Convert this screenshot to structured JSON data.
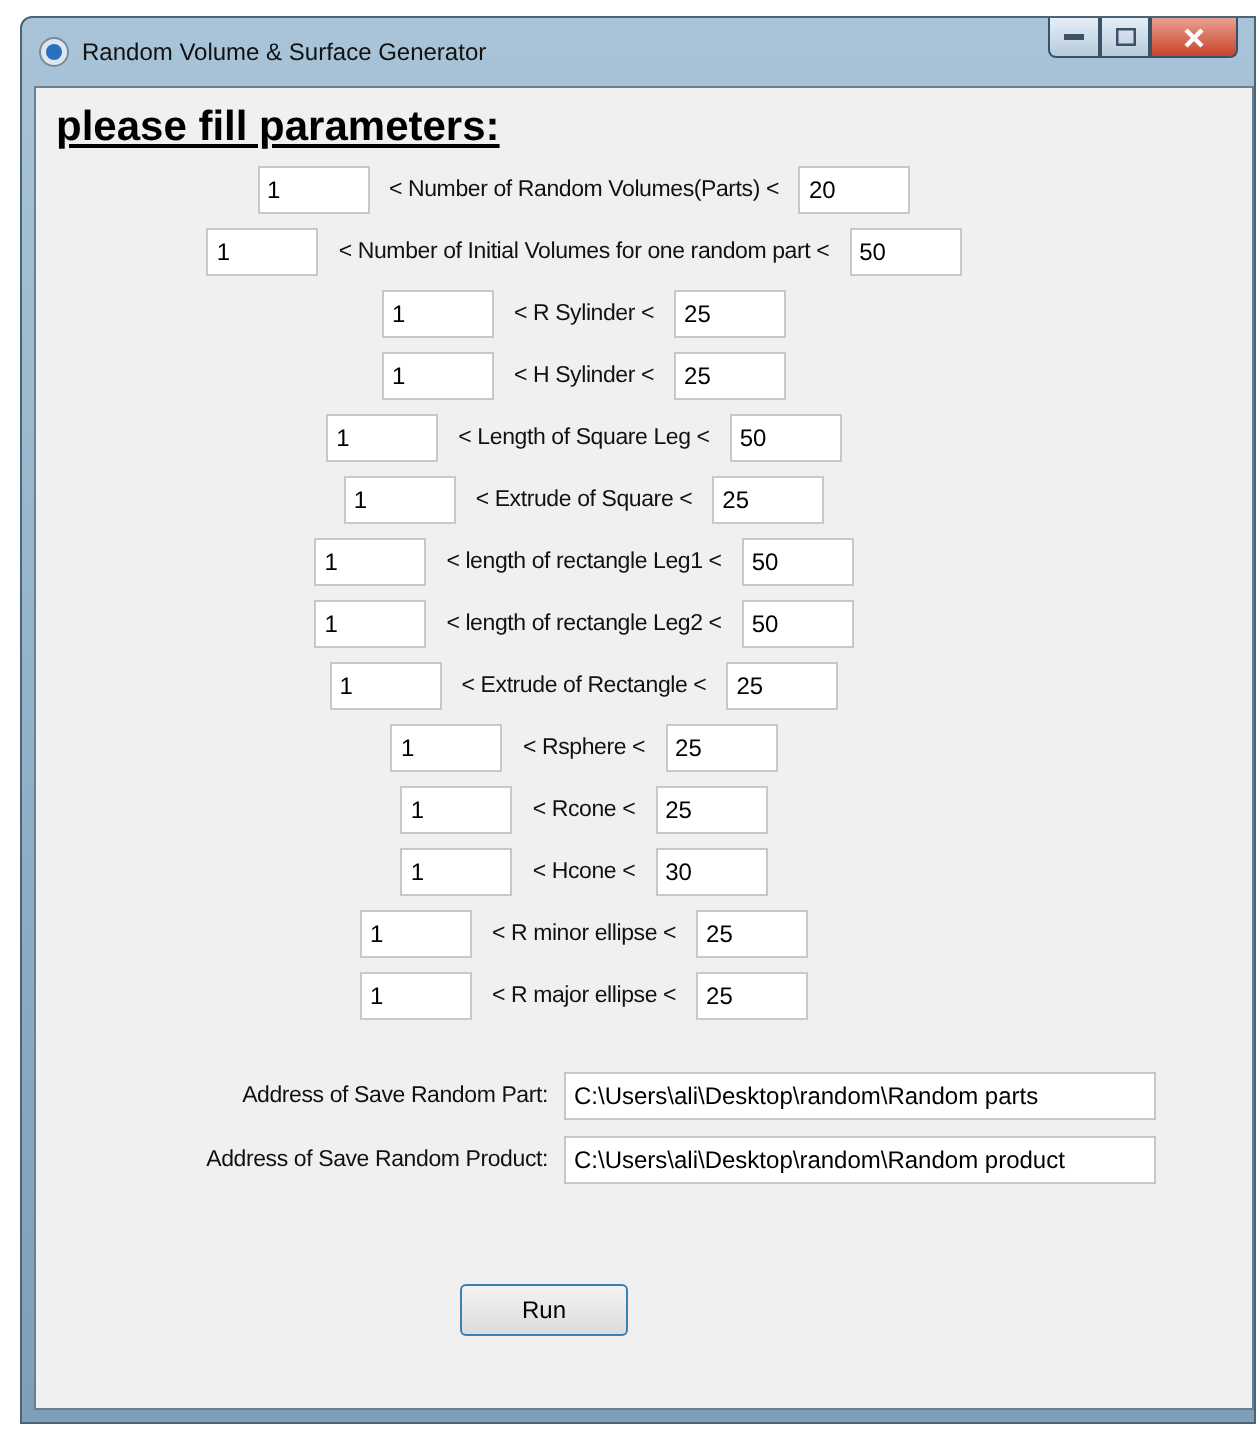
{
  "window": {
    "title": "Random Volume & Surface Generator"
  },
  "heading": "please fill parameters:",
  "ranges": [
    {
      "min": "1",
      "label": "< Number of Random Volumes(Parts) <",
      "max": "20"
    },
    {
      "min": "1",
      "label": "< Number of Initial Volumes for one random part <",
      "max": "50"
    },
    {
      "min": "1",
      "label": "< R Sylinder <",
      "max": "25"
    },
    {
      "min": "1",
      "label": "< H Sylinder <",
      "max": "25"
    },
    {
      "min": "1",
      "label": "< Length of Square Leg <",
      "max": "50"
    },
    {
      "min": "1",
      "label": "< Extrude of Square <",
      "max": "25"
    },
    {
      "min": "1",
      "label": "< length of rectangle Leg1 <",
      "max": "50"
    },
    {
      "min": "1",
      "label": "< length of rectangle Leg2 <",
      "max": "50"
    },
    {
      "min": "1",
      "label": "< Extrude of Rectangle <",
      "max": "25"
    },
    {
      "min": "1",
      "label": "< Rsphere <",
      "max": "25"
    },
    {
      "min": "1",
      "label": "< Rcone <",
      "max": "25"
    },
    {
      "min": "1",
      "label": "< Hcone <",
      "max": "30"
    },
    {
      "min": "1",
      "label": "< R minor ellipse <",
      "max": "25"
    },
    {
      "min": "1",
      "label": "< R major ellipse <",
      "max": "25"
    }
  ],
  "addresses": [
    {
      "label": "Address of Save Random Part:",
      "value": "C:\\Users\\ali\\Desktop\\random\\Random parts"
    },
    {
      "label": "Address of Save Random Product:",
      "value": "C:\\Users\\ali\\Desktop\\random\\Random product"
    }
  ],
  "run_button": "Run"
}
